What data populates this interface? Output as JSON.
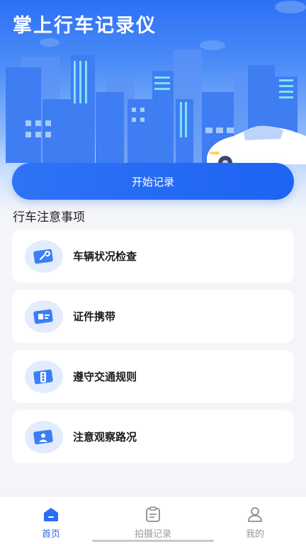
{
  "header": {
    "title": "掌上行车记录仪"
  },
  "actions": {
    "start_record": "开始记录"
  },
  "section": {
    "title": "行车注意事项"
  },
  "tips": [
    {
      "label": "车辆状况检查",
      "icon": "wrench-icon"
    },
    {
      "label": "证件携带",
      "icon": "id-card-icon"
    },
    {
      "label": "遵守交通规则",
      "icon": "traffic-light-icon"
    },
    {
      "label": "注意观察路况",
      "icon": "road-map-icon"
    }
  ],
  "tabbar": {
    "items": [
      {
        "label": "首页",
        "icon": "home-icon",
        "active": true
      },
      {
        "label": "拍摄记录",
        "icon": "clipboard-icon",
        "active": false
      },
      {
        "label": "我的",
        "icon": "user-icon",
        "active": false
      }
    ]
  },
  "colors": {
    "accent": "#2b6cf4",
    "background": "#f4f5f9",
    "icon_bg": "#e3ecfd"
  }
}
